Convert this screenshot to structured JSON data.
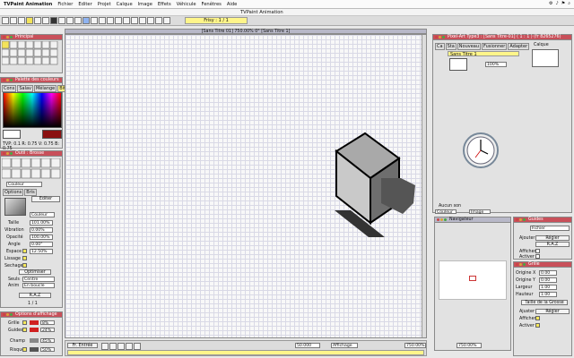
{
  "menubar": {
    "app": "TVPaint Animation",
    "items": [
      "Fichier",
      "Editer",
      "Projet",
      "Calque",
      "Image",
      "Effets",
      "Véhicule",
      "Fenêtres",
      "Aide"
    ],
    "window_title": "TVPaint Animation"
  },
  "toolbar": {
    "project_label": "Frisy : 1 / 1"
  },
  "panels": {
    "tools_title": "Principal",
    "palette_title": "Palette des couleurs",
    "palette_tabs": [
      "Cons",
      "Salav",
      "Mélange",
      "Bit"
    ],
    "palette_status": "TVP: 0.1 R: 0.75 V: 0.75 B: 0.75",
    "tool_brush_title": "Outil : Brosse",
    "options_tabs": [
      "Options",
      "Bris"
    ],
    "editer_label": "Editer",
    "couleur_label": "Couleur",
    "params": [
      {
        "label": "Taille",
        "value": "101.00%"
      },
      {
        "label": "Vibration",
        "value": "0.00%"
      },
      {
        "label": "Opacité",
        "value": "100.00%"
      },
      {
        "label": "Angle",
        "value": "0.00°"
      },
      {
        "label": "Espace",
        "value": "12.50%"
      },
      {
        "label": "Lissage",
        "value": ""
      },
      {
        "label": "Sechage",
        "value": ""
      }
    ],
    "optimiser_label": "Optimiser",
    "seuls_label": "Seuls",
    "seuls_value": "Centre",
    "anim_label": "Anim",
    "anim_value": "En boucle",
    "raz_label": "R.A.Z",
    "page_counter": "1 / 1",
    "display_opts_title": "Options d'affichage",
    "display_rows": [
      {
        "label": "Grille",
        "value": "8%"
      },
      {
        "label": "Guides",
        "value": "24%"
      },
      {
        "label": "Champ",
        "value": "45%"
      },
      {
        "label": "Risque",
        "value": "50%"
      }
    ]
  },
  "canvas": {
    "title": "[Sans Titre 01] 750.00% 0° [Sans Titre 1]"
  },
  "timeline": {
    "title": "Pixel-Art Type3 : [Sans Titre-01] ( 1 : 1 ) (fr 8265276)",
    "columns": [
      "Calque"
    ],
    "cols": [
      "Ca",
      "Sta",
      "Nouveau",
      "Fusionner",
      "Adapter"
    ],
    "layer_name": "Sans Titre 1",
    "opacity": "100%",
    "bottom_label": "Aucun son",
    "dropdown": "Couleur",
    "image_label": "Image"
  },
  "navigator": {
    "title": "Navigateur",
    "zoom": "750.00%"
  },
  "guides": {
    "title": "Guides",
    "dropdown": "Fichier",
    "ajouter": "Ajouter",
    "regler": "Régler",
    "raz": "R.A.Z",
    "afficher": "Afficher",
    "activer": "Activer"
  },
  "grid": {
    "title": "Grille",
    "rows": [
      {
        "label": "Origine X",
        "value": "0.00"
      },
      {
        "label": "Origine Y",
        "value": "0.00"
      },
      {
        "label": "Largeur",
        "value": "1.00"
      },
      {
        "label": "Hauteur",
        "value": "1.00"
      }
    ],
    "taille": "Taille de la Grosse",
    "ajuster": "Ajuster",
    "regler": "Régler",
    "afficher": "Afficher",
    "activer": "Activer"
  },
  "bottom": {
    "left_label": "Fr. Entrée",
    "right_label": "Fr. Sortie",
    "zoom_select": "50.000",
    "affichage": "Affichage",
    "zoom_val": "750.00%",
    "mode": "Image"
  }
}
